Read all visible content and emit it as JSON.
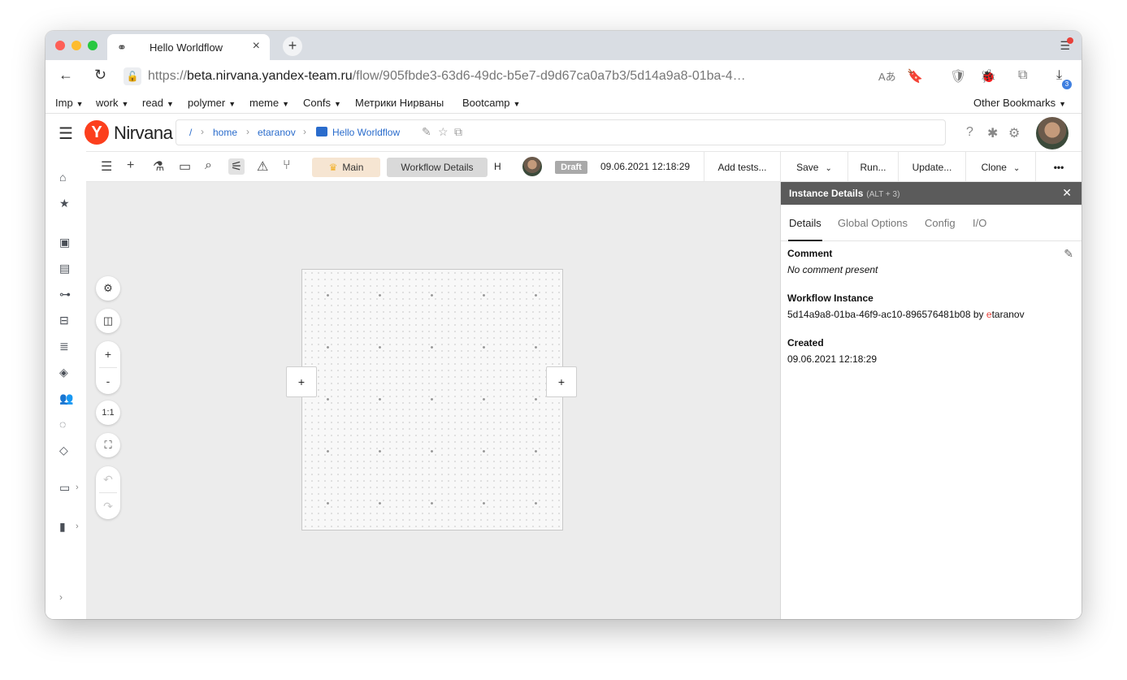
{
  "browser": {
    "tab_title": "Hello Worldflow",
    "url_scheme": "https://",
    "url_host": "beta.nirvana.yandex-team.ru",
    "url_path": "/flow/905fbde3-63d6-49dc-b5e7-d9d67ca0a7b3/5d14a9a8-01ba-4…",
    "downloads_badge": "3",
    "bookmarks": [
      {
        "label": "Imp",
        "folder": true
      },
      {
        "label": "work",
        "folder": true
      },
      {
        "label": "read",
        "folder": true
      },
      {
        "label": "polymer",
        "folder": true
      },
      {
        "label": "meme",
        "folder": true
      },
      {
        "label": "Confs",
        "folder": true
      },
      {
        "label": "Метрики Нирваны",
        "folder": false
      },
      {
        "label": "Bootcamp",
        "folder": true
      }
    ],
    "other_bookmarks": "Other Bookmarks"
  },
  "app": {
    "logo_letter": "Y",
    "logo_text": "Nirvana",
    "breadcrumb": [
      "/",
      "home",
      "etaranov",
      "Hello Worldflow"
    ]
  },
  "toolbar": {
    "main_label": "Main",
    "workflow_details_label": "Workflow Details",
    "h_label": "H",
    "status_badge": "Draft",
    "date": "09.06.2021 12:18:29",
    "add_tests": "Add tests...",
    "save": "Save",
    "run": "Run...",
    "update": "Update...",
    "clone": "Clone",
    "more": "•••"
  },
  "canvas": {
    "zoom_in": "+",
    "zoom_out": "-",
    "zoom_reset": "1:1",
    "add_left": "+",
    "add_right": "+"
  },
  "panel": {
    "title": "Instance Details",
    "shortcut": "(ALT + 3)",
    "tabs": [
      "Details",
      "Global Options",
      "Config",
      "I/O"
    ],
    "active_tab": "Details",
    "comment_label": "Comment",
    "comment_value": "No comment present",
    "instance_label": "Workflow Instance",
    "instance_id": "5d14a9a8-01ba-46f9-ac10-896576481b08",
    "instance_by": " by ",
    "instance_user_first": "e",
    "instance_user_rest": "taranov",
    "created_label": "Created",
    "created_value": "09.06.2021 12:18:29"
  },
  "colors": {
    "yandex_red": "#fc3f1d",
    "link_blue": "#2a6ccc",
    "panel_header": "#5b5b5b",
    "main_pill": "#f6e5d2"
  }
}
